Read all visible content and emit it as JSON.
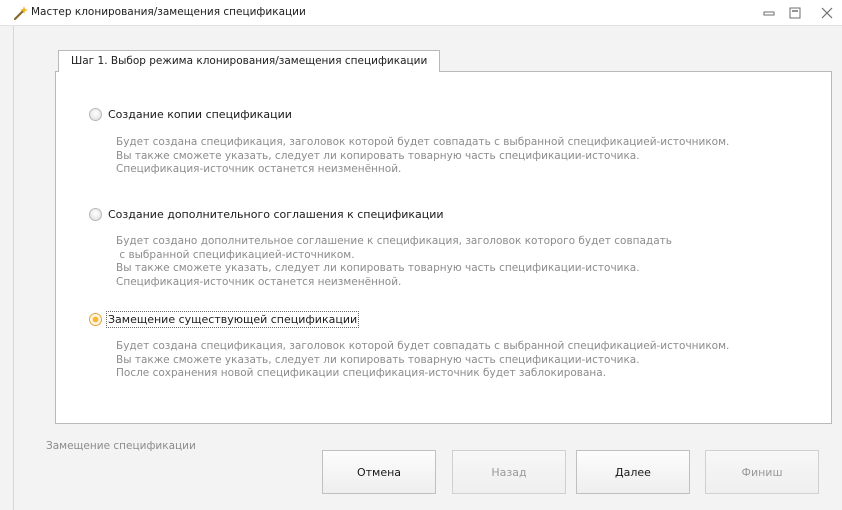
{
  "window": {
    "title": "Мастер клонирования/замещения спецификации",
    "icon": "wand-icon",
    "accent": "#f9b533"
  },
  "tab": {
    "label": "Шаг 1. Выбор режима клонирования/замещения спецификации"
  },
  "options": [
    {
      "label": "Создание копии спецификации",
      "checked": false,
      "description": "Будет создана спецификация, заголовок которой будет совпадать с выбранной спецификацией-источником.\nВы также сможете указать, следует ли копировать товарную часть спецификации-источика.\nСпецификация-источник останется неизменённой."
    },
    {
      "label": "Создание дополнительного соглашения к спецификации",
      "checked": false,
      "description": "Будет создано дополнительное соглашение к спецификация, заголовок которого будет совпадать\n с выбранной спецификацией-источником.\nВы также сможете указать, следует ли копировать товарную часть спецификации-источика.\nСпецификация-источник останется неизменённой."
    },
    {
      "label": "Замещение существующей спецификации",
      "checked": true,
      "description": "Будет создана спецификация, заголовок которой будет совпадать с выбранной спецификацией-источником.\nВы также сможете указать, следует ли копировать товарную часть спецификации-источика.\nПосле сохранения новой спецификации спецификация-источник будет заблокирована."
    }
  ],
  "status": {
    "text": "Замещение спецификации"
  },
  "buttons": {
    "cancel": "Отмена",
    "back": "Назад",
    "next": "Далее",
    "finish": "Финиш"
  }
}
